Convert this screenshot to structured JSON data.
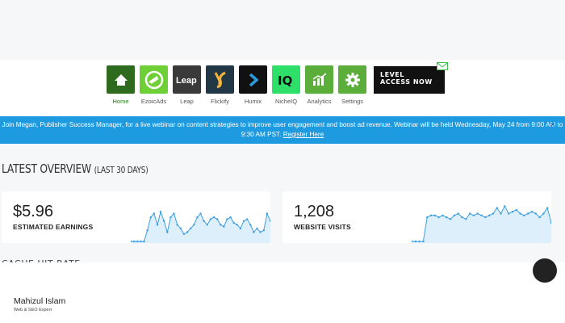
{
  "nav": {
    "items": [
      {
        "label": "Home",
        "icon": "home-icon",
        "bg": "#2e6b1f"
      },
      {
        "label": "EzoicAds",
        "icon": "ezoicads-icon",
        "bg": "#6fcf36"
      },
      {
        "label": "Leap",
        "icon": "leap-icon",
        "bg": "#3a3a3a"
      },
      {
        "label": "Flickify",
        "icon": "flickify-icon",
        "bg": "#233847"
      },
      {
        "label": "Humix",
        "icon": "humix-icon",
        "bg": "#111111"
      },
      {
        "label": "NicheIQ",
        "icon": "nicheiq-icon",
        "bg": "#2ee06a"
      },
      {
        "label": "Analytics",
        "icon": "analytics-icon",
        "bg": "#5cae3a"
      },
      {
        "label": "Settings",
        "icon": "settings-icon",
        "bg": "#5cae3a"
      }
    ],
    "level_button": {
      "line1": "LEVEL",
      "line2": "ACCESS NOW"
    }
  },
  "banner": {
    "text": "Join Megan, Publisher Success Manager, for a live webinar on content strategies to improve user engagement and boost ad revenue. Webinar will be held Wednesday, May 24 from 9:00 AM to 9:30 AM PST.",
    "link": "Register Here",
    "close": "×"
  },
  "overview": {
    "title": "LATEST OVERVIEW",
    "period": "(LAST 30 DAYS)"
  },
  "cards": [
    {
      "value": "$5.96",
      "label": "ESTIMATED EARNINGS",
      "trend": [
        0,
        0,
        0,
        0,
        0,
        12,
        26,
        30,
        18,
        32,
        22,
        10,
        26,
        30,
        18,
        14,
        8,
        10,
        14,
        18,
        26,
        30,
        22,
        18,
        24,
        26,
        24,
        18,
        16,
        24,
        26,
        20,
        18,
        14,
        22,
        24,
        18,
        10,
        14,
        10,
        12,
        30,
        22
      ]
    },
    {
      "value": "1,208",
      "label": "WEBSITE VISITS",
      "trend": [
        0,
        0,
        0,
        0,
        26,
        28,
        28,
        26,
        28,
        26,
        24,
        28,
        30,
        26,
        24,
        30,
        28,
        30,
        28,
        26,
        28,
        30,
        36,
        30,
        38,
        30,
        32,
        34,
        30,
        28,
        30,
        32,
        30,
        26,
        30,
        36,
        20
      ]
    }
  ],
  "section": {
    "cache_title": "CACHE HIT RATE"
  },
  "author": {
    "name": "Mahizul Islam",
    "role": "Web & SEO Expert"
  },
  "colors": {
    "banner": "#1e9be0",
    "accent": "#5cae3a",
    "spark_line": "#3a9ee0",
    "spark_fill": "#dceffb"
  }
}
